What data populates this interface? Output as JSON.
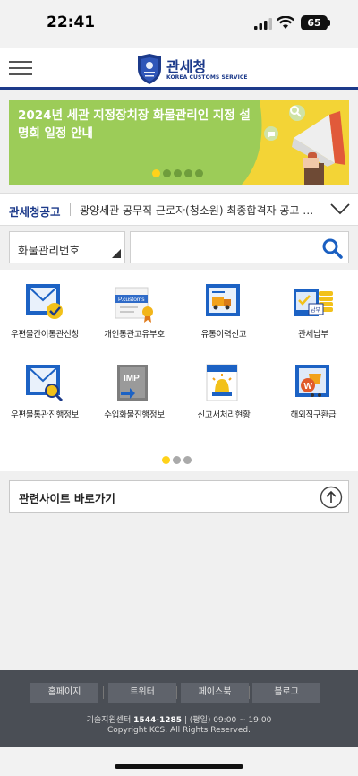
{
  "status": {
    "time": "22:41",
    "battery": "65"
  },
  "header": {
    "title": "관세청",
    "subtitle": "KOREA CUSTOMS SERVICE"
  },
  "banner": {
    "text": "2024년 세관 지정장치장 화물관리인 지정 설명회 일정 안내",
    "pages": 5,
    "active_page": 1
  },
  "notice": {
    "label": "관세청공고",
    "text": "광양세관 공무직 근로자(청소원) 최종합격자 공고 및…"
  },
  "search": {
    "selected": "화물관리번호",
    "value": "",
    "placeholder": ""
  },
  "menu": {
    "items": [
      {
        "label": "우편물간이통관신청",
        "icon": "mail-check-icon"
      },
      {
        "label": "개인통관고유부호",
        "icon": "pcustoms-card-icon",
        "badge": "P.customs"
      },
      {
        "label": "유통이력신고",
        "icon": "truck-delivery-icon"
      },
      {
        "label": "관세납부",
        "icon": "tax-payment-icon",
        "badge": "납부"
      },
      {
        "label": "우편물통관진행정보",
        "icon": "mail-search-icon"
      },
      {
        "label": "수입화물진행정보",
        "icon": "import-cargo-icon",
        "badge": "IMP"
      },
      {
        "label": "신고서처리현황",
        "icon": "report-alarm-icon"
      },
      {
        "label": "해외직구환급",
        "icon": "overseas-refund-icon",
        "badge": "W"
      }
    ],
    "pages": 3,
    "active_page": 1
  },
  "related": {
    "label": "관련사이트 바로가기"
  },
  "footer": {
    "links": [
      "홈페이지",
      "트위터",
      "페이스북",
      "블로그"
    ],
    "center_label": "기술지원센터",
    "phone": "1544-1285",
    "hours": "| (평일) 09:00 ~ 19:00",
    "copyright": "Copyright KCS. All Rights Reserved."
  },
  "colors": {
    "brand": "#1c3a8a",
    "banner": "#9ccc58",
    "accent": "#ffd21a",
    "footer": "#4a4e55"
  }
}
